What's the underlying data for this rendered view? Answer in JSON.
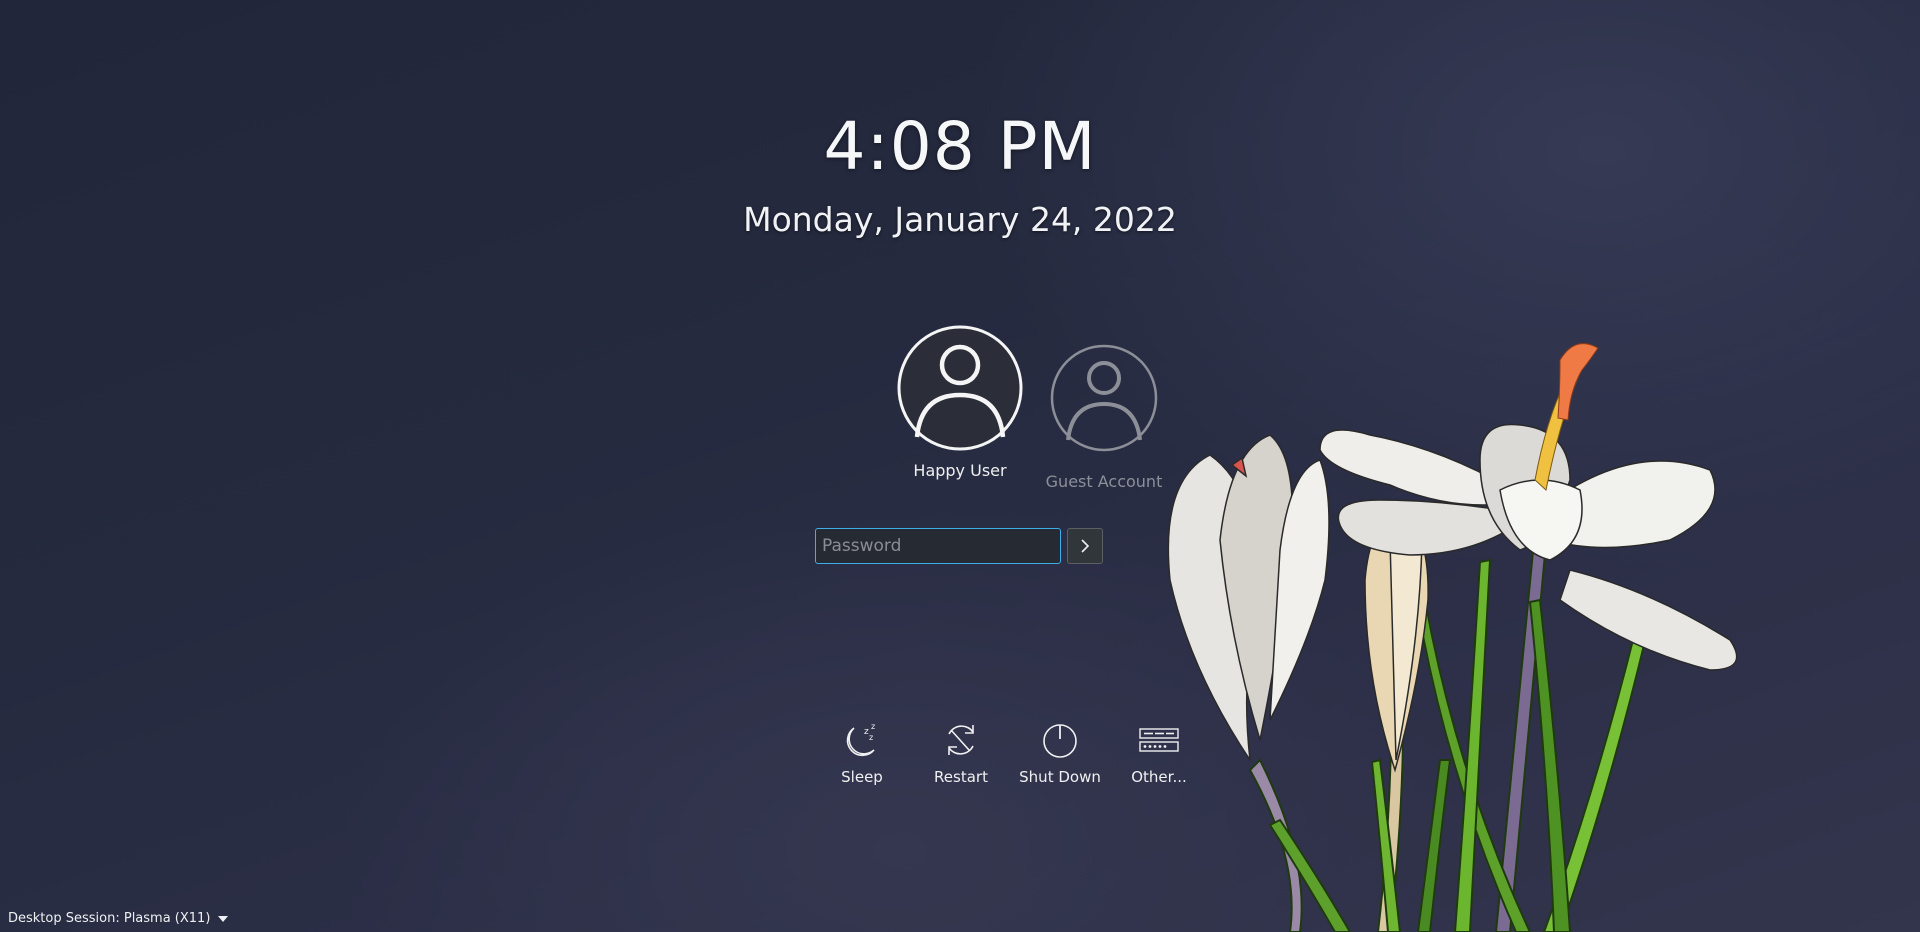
{
  "clock": {
    "time": "4:08 PM",
    "date": "Monday, January 24, 2022"
  },
  "users": [
    {
      "name": "Happy User",
      "icon": "user-avatar-icon",
      "selected": true
    },
    {
      "name": "Guest Account",
      "icon": "user-avatar-icon",
      "selected": false
    }
  ],
  "login": {
    "password_placeholder": "Password",
    "submit_icon": "chevron-right-icon",
    "accent": "#3daee9"
  },
  "actions": [
    {
      "label": "Sleep",
      "icon": "sleep-moon-icon"
    },
    {
      "label": "Restart",
      "icon": "restart-icon"
    },
    {
      "label": "Shut Down",
      "icon": "power-icon"
    },
    {
      "label": "Other...",
      "icon": "other-options-icon"
    }
  ],
  "session": {
    "label": "Desktop Session: Plasma (X11)",
    "icon": "dropdown-arrow-icon"
  }
}
